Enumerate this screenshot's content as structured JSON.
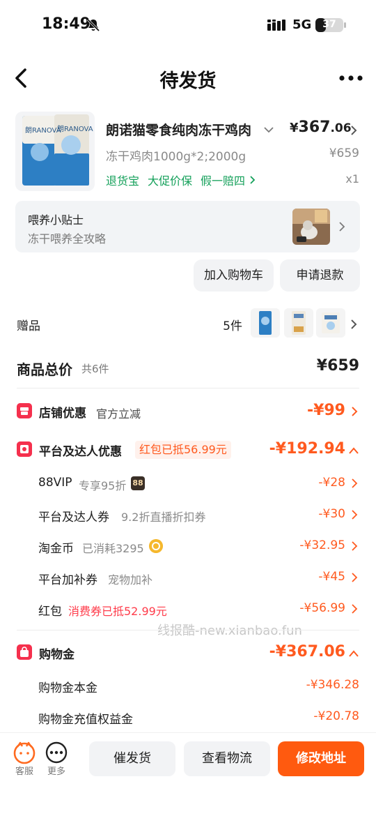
{
  "status_bar": {
    "time": "18:49",
    "network": "5G",
    "battery_level": "37"
  },
  "nav": {
    "title": "待发货"
  },
  "product": {
    "name": "朗诺猫零食纯肉冻干鸡肉",
    "price_currency": "¥",
    "price_integer": "367",
    "price_decimal": ".06",
    "spec": "冻干鸡肉1000g*2;2000g",
    "original_price": "¥659",
    "tags": [
      "退货宝",
      "大促价保",
      "假一赔四"
    ],
    "quantity": "x1",
    "brand_text": "朗RANOVA"
  },
  "tips": {
    "title": "喂养小贴士",
    "subtitle": "冻干喂养全攻略"
  },
  "actions": {
    "add_cart": "加入购物车",
    "refund": "申请退款"
  },
  "gifts": {
    "label": "赠品",
    "count": "5件"
  },
  "total": {
    "label": "商品总价",
    "count": "共6件",
    "value": "¥659"
  },
  "store_discount": {
    "label": "店铺优惠",
    "sub": "官方立减",
    "amount": "-¥99"
  },
  "platform_discount": {
    "label": "平台及达人优惠",
    "badge": "红包已抵56.99元",
    "amount": "-¥192.94",
    "items": [
      {
        "label": "88VIP",
        "sub": "专享95折",
        "badge": "88",
        "amount": "-¥28"
      },
      {
        "label": "平台及达人券",
        "sub": "9.2折直播折扣券",
        "amount": "-¥30"
      },
      {
        "label": "淘金币",
        "sub": "已消耗3295",
        "amount": "-¥32.95"
      },
      {
        "label": "平台加补券",
        "sub": "宠物加补",
        "amount": "-¥45"
      },
      {
        "label": "红包",
        "sub": "消费券已抵52.99元",
        "amount": "-¥56.99"
      }
    ]
  },
  "shopping_gold": {
    "label": "购物金",
    "amount": "-¥367.06",
    "items": [
      {
        "label": "购物金本金",
        "amount": "-¥346.28"
      },
      {
        "label": "购物金充值权益金",
        "amount": "-¥20.78"
      }
    ]
  },
  "watermark": "线报酷-new.xianbao.fun",
  "bottom_bar": {
    "service_label": "客服",
    "more_label": "更多",
    "urge_button": "催发货",
    "logistics_button": "查看物流",
    "address_button": "修改地址"
  },
  "colors": {
    "accent": "#ff5a0f",
    "discount": "#ff5a1f",
    "tag_green": "#14a05a",
    "section_red": "#f5304d"
  }
}
